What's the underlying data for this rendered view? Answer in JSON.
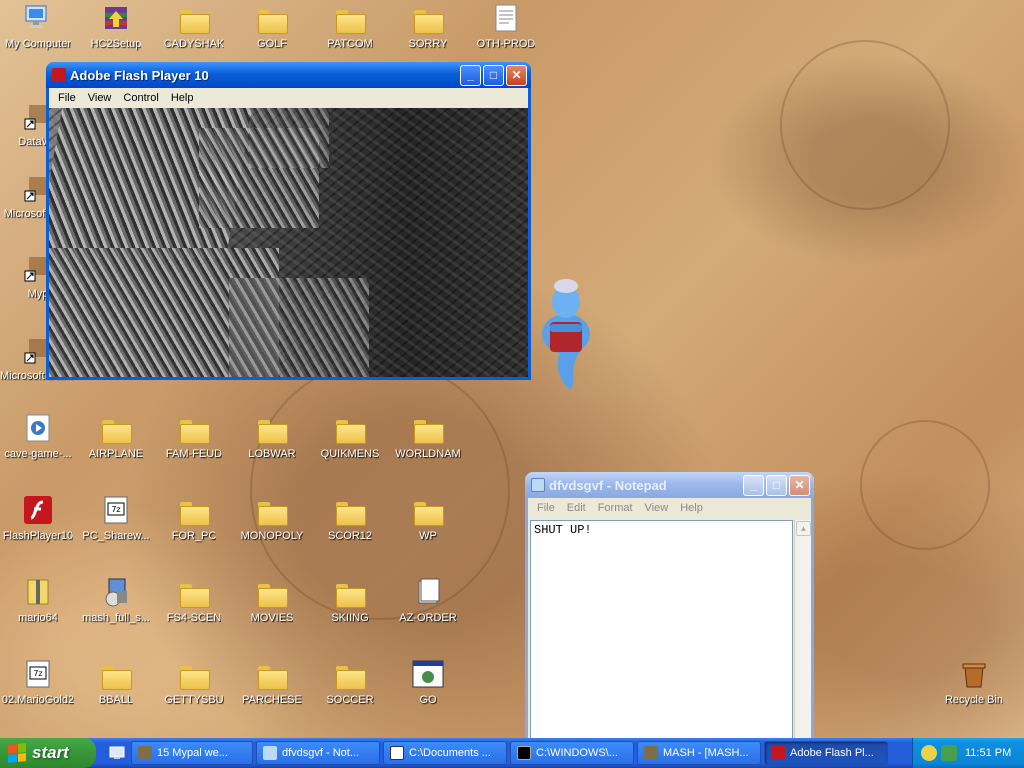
{
  "desktop": {
    "icons": [
      {
        "label": "My Computer",
        "kind": "computer"
      },
      {
        "label": "HC2Setup",
        "kind": "installer"
      },
      {
        "label": "CADYSHAK",
        "kind": "folder"
      },
      {
        "label": "GOLF",
        "kind": "folder"
      },
      {
        "label": "PATCOM",
        "kind": "folder"
      },
      {
        "label": "SORRY",
        "kind": "folder"
      },
      {
        "label": "OTH-PROD",
        "kind": "document"
      },
      {
        "label": "DataWa",
        "kind": "shortcut"
      },
      {
        "label": "Microsoft C++",
        "kind": "shortcut"
      },
      {
        "label": "Myp",
        "kind": "shortcut"
      },
      {
        "label": "Microsoft Basic 6.0",
        "kind": "shortcut"
      },
      {
        "label": "cave-game-...",
        "kind": "media"
      },
      {
        "label": "AIRPLANE",
        "kind": "folder"
      },
      {
        "label": "FAM-FEUD",
        "kind": "folder"
      },
      {
        "label": "LOBWAR",
        "kind": "folder"
      },
      {
        "label": "QUIKMENS",
        "kind": "folder"
      },
      {
        "label": "WORLDNAM",
        "kind": "folder"
      },
      {
        "label": "FlashPlayer10",
        "kind": "flash"
      },
      {
        "label": "PC_Sharew...",
        "kind": "7z"
      },
      {
        "label": "FOR_PC",
        "kind": "folder"
      },
      {
        "label": "MONOPOLY",
        "kind": "folder"
      },
      {
        "label": "SCOR12",
        "kind": "folder"
      },
      {
        "label": "WP",
        "kind": "folder"
      },
      {
        "label": "mario64",
        "kind": "zip"
      },
      {
        "label": "mash_full_s...",
        "kind": "installer2"
      },
      {
        "label": "FS4-SCEN",
        "kind": "folder"
      },
      {
        "label": "MOVIES",
        "kind": "folder"
      },
      {
        "label": "SKIING",
        "kind": "folder"
      },
      {
        "label": "AZ-ORDER",
        "kind": "document2"
      },
      {
        "label": "02.MarioGold2",
        "kind": "7z"
      },
      {
        "label": "BBALL",
        "kind": "folder"
      },
      {
        "label": "GETTYSBU",
        "kind": "folder"
      },
      {
        "label": "PARCHESE",
        "kind": "folder"
      },
      {
        "label": "SOCCER",
        "kind": "folder"
      },
      {
        "label": "GO",
        "kind": "app"
      },
      {
        "label": "Recycle Bin",
        "kind": "recycle"
      }
    ]
  },
  "flash_window": {
    "title": "Adobe Flash Player 10",
    "menu": [
      "File",
      "View",
      "Control",
      "Help"
    ]
  },
  "notepad_window": {
    "title": "dfvdsgvf - Notepad",
    "menu": [
      "File",
      "Edit",
      "Format",
      "View",
      "Help"
    ],
    "text": "SHUT UP!"
  },
  "taskbar": {
    "start_label": "start",
    "tasks": [
      {
        "label": "15 Mypal we...",
        "bold_count": "15",
        "active": false
      },
      {
        "label": "dfvdsgvf - Not...",
        "active": false
      },
      {
        "label": "C:\\Documents ...",
        "active": false
      },
      {
        "label": "C:\\WINDOWS\\...",
        "active": false
      },
      {
        "label": "MASH - [MASH...",
        "active": false
      },
      {
        "label": "Adobe Flash Pl...",
        "active": true
      }
    ],
    "clock": "11:51 PM"
  },
  "colors": {
    "titlebar_active": "#0a5fd8",
    "taskbar": "#245edb",
    "start": "#3b9a3b",
    "tray": "#0f8fe0"
  }
}
